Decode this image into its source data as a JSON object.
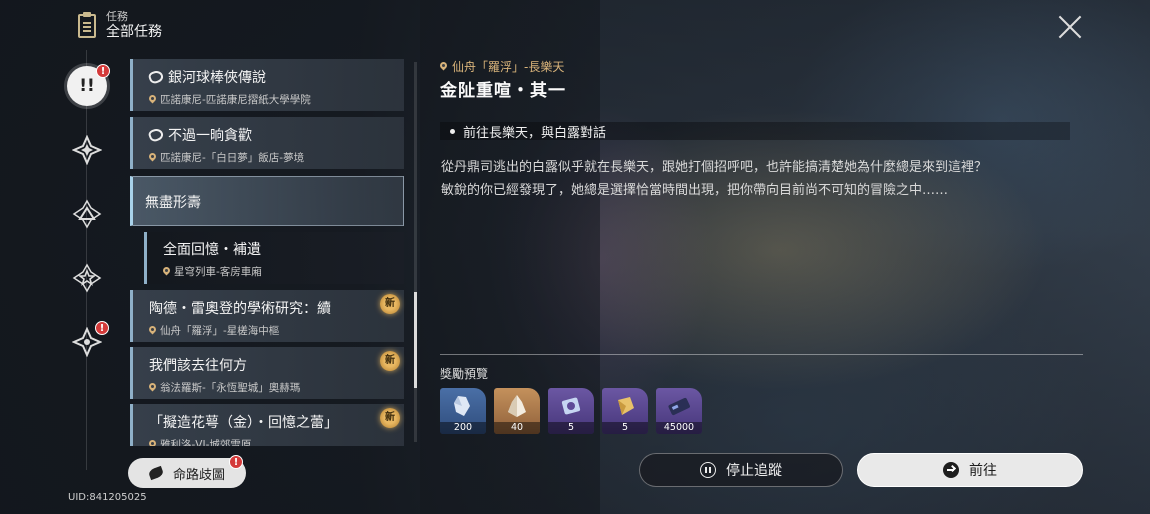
{
  "header": {
    "section": "任務",
    "title": "全部任務"
  },
  "rail": {
    "active_label": "!!",
    "alert_badge": "!"
  },
  "list": {
    "items": [
      {
        "title": "銀河球棒俠傳說",
        "location": "匹諾康尼-匹諾康尼摺紙大學學院"
      },
      {
        "title": "不過一晌貪歡",
        "location": "匹諾康尼-「白日夢」飯店-夢境"
      }
    ],
    "group": {
      "title": "無盡形壽"
    },
    "selected": {
      "title": "全面回憶・補遺",
      "location": "星穹列車-客房車廂"
    },
    "new_items": [
      {
        "title": "陶德・雷奧登的學術研究：續",
        "location": "仙舟「羅浮」-星槎海中樞",
        "badge": "新"
      },
      {
        "title": "我們該去往何方",
        "location": "翁法羅斯-「永恆聖城」奧赫瑪",
        "badge": "新"
      },
      {
        "title": "「擬造花萼（金）・回憶之蕾」",
        "location": "雅利洛-VI-城郊雪原",
        "badge": "新"
      }
    ]
  },
  "map_button": {
    "label": "命路歧圖",
    "badge": "!"
  },
  "uid": "UID:841205025",
  "detail": {
    "location": "仙舟「羅浮」-長樂天",
    "title": "金阯重喧・其一",
    "objective": "前往長樂天，與白露對話",
    "description_lines": [
      "從丹鼎司逃出的白露似乎就在長樂天，跟她打個招呼吧，也許能搞清楚她為什麼總是來到這裡？",
      "敏銳的你已經發現了，她總是選擇恰當時間出現，把你帶向目前尚不可知的冒險之中……"
    ],
    "reward_label": "獎勵預覽",
    "rewards": [
      {
        "icon": "crystal-icon",
        "qty": "200",
        "color": "blue"
      },
      {
        "icon": "stellar-jade-icon",
        "qty": "40",
        "color": "gold"
      },
      {
        "icon": "purple-material-icon",
        "qty": "5",
        "color": "purple"
      },
      {
        "icon": "gold-material-icon",
        "qty": "5",
        "color": "purple"
      },
      {
        "icon": "credit-icon",
        "qty": "45000",
        "color": "purple"
      }
    ]
  },
  "buttons": {
    "stop": "停止追蹤",
    "go": "前往"
  }
}
